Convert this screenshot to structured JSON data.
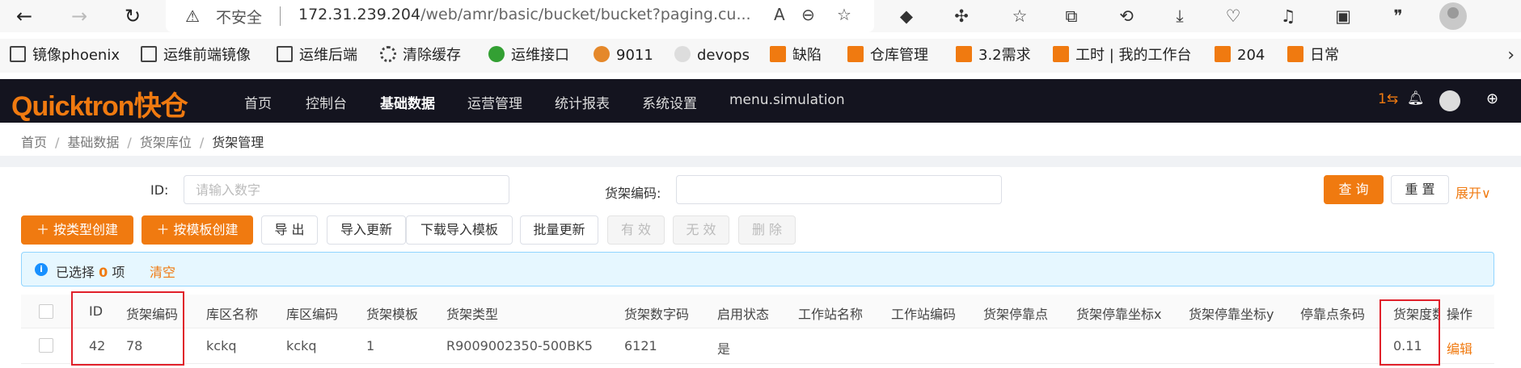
{
  "browser": {
    "url_insecure_label": "不安全",
    "url_host": "172.31.239.204",
    "url_path": "/web/amr/basic/bucket/bucket?paging.cu..."
  },
  "bookmarks": [
    {
      "label": "镜像phoenix",
      "icon": "page-icon"
    },
    {
      "label": "运维前端镜像",
      "icon": "page-icon"
    },
    {
      "label": "运维后端",
      "icon": "page-icon"
    },
    {
      "label": "清除缓存",
      "icon": "gear-icon"
    },
    {
      "label": "运维接口",
      "icon": "api-icon"
    },
    {
      "label": "9011",
      "icon": "site-icon"
    },
    {
      "label": "devops",
      "icon": "cup-icon"
    },
    {
      "label": "缺陷",
      "icon": "quicktron-icon"
    },
    {
      "label": "仓库管理",
      "icon": "quicktron-icon"
    },
    {
      "label": "3.2需求",
      "icon": "quicktron-icon"
    },
    {
      "label": "工时 | 我的工作台",
      "icon": "quicktron-icon"
    },
    {
      "label": "204",
      "icon": "quicktron-icon"
    },
    {
      "label": "日常",
      "icon": "quicktron-icon"
    }
  ],
  "header": {
    "logo": "Quicktron快仓",
    "nav": [
      "首页",
      "控制台",
      "基础数据",
      "运营管理",
      "统计报表",
      "系统设置",
      "menu.simulation"
    ],
    "active_nav": "基础数据",
    "badge": "1⇆",
    "accent": "#f07a10",
    "bg": "#14141f"
  },
  "breadcrumb": [
    "首页",
    "基础数据",
    "货架库位",
    "货架管理"
  ],
  "filters": {
    "id_label": "ID:",
    "id_placeholder": "请输入数字",
    "code_label": "货架编码:",
    "code_value": ""
  },
  "buttons": {
    "query": "查 询",
    "reset": "重 置",
    "expand": "展开",
    "create_by_type": "按类型创建",
    "create_by_template": "按模板创建",
    "export": "导 出",
    "import_update": "导入更新",
    "download_template": "下载导入模板",
    "batch_update": "批量更新",
    "enable": "有 效",
    "disable": "无 效",
    "delete": "删 除"
  },
  "selection": {
    "prefix": "已选择",
    "count": "0",
    "suffix": "项",
    "clear": "清空"
  },
  "table": {
    "columns": [
      "ID",
      "货架编码",
      "库区名称",
      "库区编码",
      "货架模板",
      "货架类型",
      "货架数字码",
      "启用状态",
      "工作站名称",
      "工作站编码",
      "货架停靠点",
      "货架停靠坐标x",
      "货架停靠坐标y",
      "停靠点条码",
      "货架度数",
      "操作"
    ],
    "rows": [
      [
        "42",
        "78",
        "kckq",
        "kckq",
        "1",
        "R9009002350-500BK5",
        "6121",
        "是",
        "",
        "",
        "",
        "",
        "",
        "",
        "0.11",
        "编辑"
      ]
    ]
  }
}
